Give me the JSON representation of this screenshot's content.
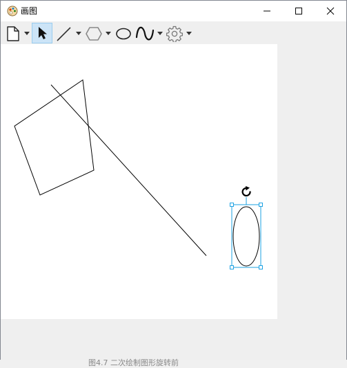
{
  "window": {
    "title": "画图"
  },
  "titlebar_buttons": {
    "minimize": "minimize-icon",
    "maximize": "maximize-icon",
    "close": "close-icon"
  },
  "toolbar": {
    "items": [
      "new-document-icon",
      "select-arrow-icon",
      "line-tool-icon",
      "hexagon-tool-icon",
      "ellipse-tool-icon",
      "curve-tool-icon",
      "settings-gear-icon"
    ],
    "selected_tool": "select"
  },
  "colors": {
    "selection": "#1ba1e2",
    "stroke": "#000000",
    "canvas": "#ffffff",
    "background": "#efefef"
  },
  "canvas": {
    "shapes": [
      "line",
      "pentagon",
      "ellipse"
    ],
    "selected_shape": "ellipse"
  },
  "caption": "图4.7 二次绘制图形旋转前"
}
